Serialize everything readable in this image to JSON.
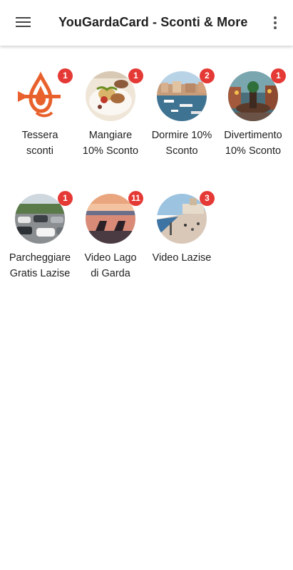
{
  "appbar": {
    "title": "YouGardaCard - Sconti & More",
    "menu_icon": "hamburger-menu-icon",
    "more_icon": "more-vertical-icon"
  },
  "colors": {
    "badge": "#e53935",
    "accent": "#e8612c"
  },
  "tiles": [
    {
      "label_line1": "Tessera",
      "label_line2": "sconti",
      "badge": "1",
      "icon": "tessera-logo-icon"
    },
    {
      "label_line1": "Mangiare",
      "label_line2": "10% Sconto",
      "badge": "1",
      "icon": "food-photo"
    },
    {
      "label_line1": "Dormire 10%",
      "label_line2": "Sconto",
      "badge": "2",
      "icon": "harbor-photo"
    },
    {
      "label_line1": "Divertimento",
      "label_line2": "10% Sconto",
      "badge": "1",
      "icon": "fountain-photo"
    },
    {
      "label_line1": "Parcheggiare",
      "label_line2": "Gratis Lazise",
      "badge": "1",
      "icon": "parking-photo"
    },
    {
      "label_line1": "Video Lago",
      "label_line2": "di Garda",
      "badge": "11",
      "icon": "sunset-lake-photo"
    },
    {
      "label_line1": "Video Lazise",
      "label_line2": "",
      "badge": "3",
      "icon": "promenade-photo"
    }
  ]
}
